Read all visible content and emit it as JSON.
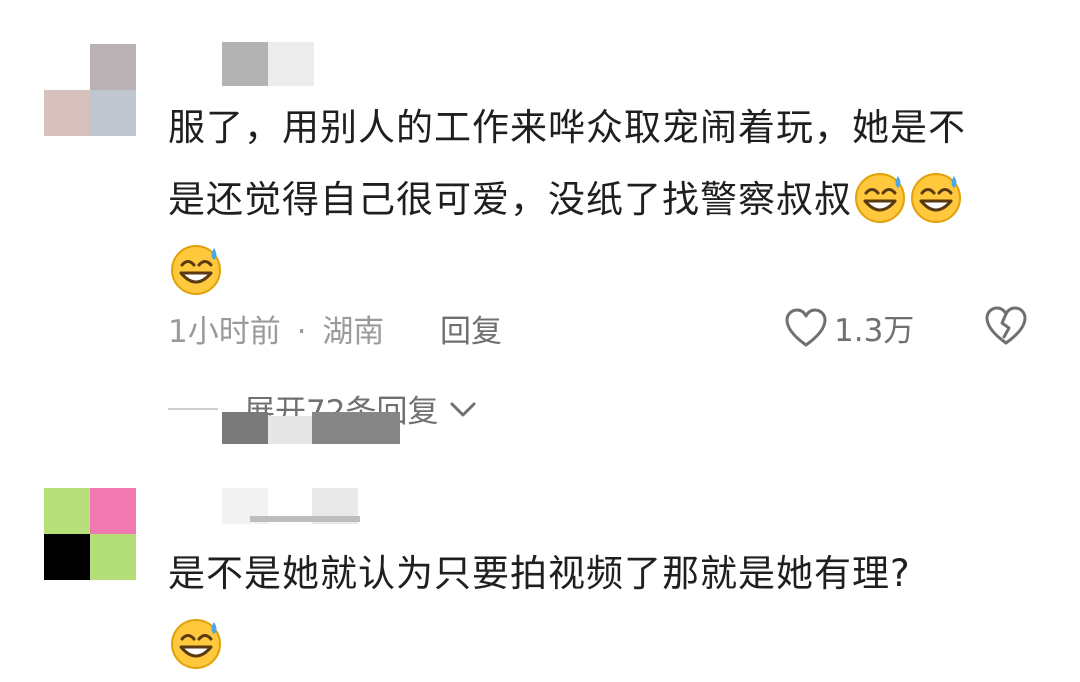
{
  "comments": [
    {
      "text_line1": "服了，用别人的工作来哗众取宠闹着玩，她是不",
      "text_line2": "是还觉得自己很可爱，没纸了找警察叔叔",
      "emoji_icon": "grinning-sweat-emoji",
      "time": "1小时前",
      "separator": "·",
      "location": "湖南",
      "reply_label": "回复",
      "like_count": "1.3万",
      "expand_label": "展开72条回复"
    },
    {
      "text_line1": "是不是她就认为只要拍视频了那就是她有理?",
      "emoji_icon": "grinning-sweat-emoji"
    }
  ],
  "colors": {
    "text": "#1f1f1f",
    "meta": "#9a9a9a",
    "action": "#707070",
    "emoji_face": "#ffc83d",
    "emoji_sweat": "#4aa8e8"
  }
}
